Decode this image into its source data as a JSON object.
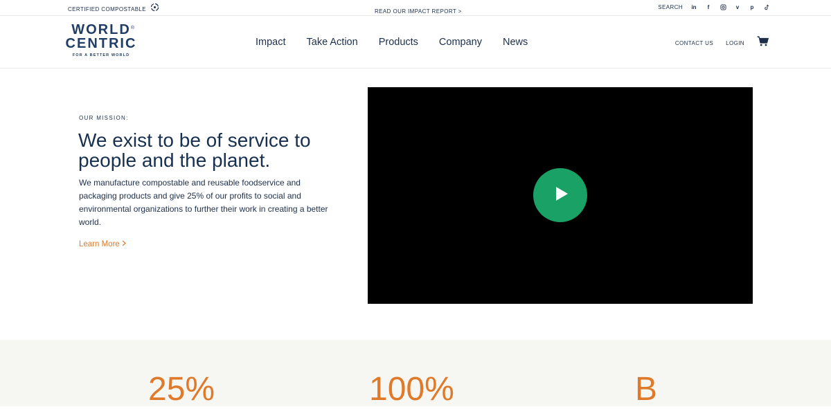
{
  "utility_bar": {
    "certified_label": "CERTIFIED COMPOSTABLE",
    "impact_report_link": "READ OUR IMPACT REPORT >",
    "search_label": "SEARCH",
    "socials": [
      "linkedin-icon",
      "facebook-icon",
      "instagram-icon",
      "vimeo-icon",
      "pinterest-icon",
      "tiktok-icon"
    ]
  },
  "header": {
    "logo": {
      "line1": "WORLD",
      "line2": "CENTRIC",
      "reg": "®",
      "tagline": "FOR A BETTER WORLD"
    },
    "nav": [
      "Impact",
      "Take Action",
      "Products",
      "Company",
      "News"
    ],
    "contact_label": "CONTACT US",
    "login_label": "LOGIN"
  },
  "hero": {
    "eyebrow": "OUR MISSION:",
    "title": "We exist to be of service to people and the planet.",
    "body": "We manufacture compostable and reusable foodservice and packaging products and give 25% of our profits to social and environmental organizations to further their work in creating a better world.",
    "learn_more": "Learn More",
    "learn_more_chevron": ">"
  },
  "stats": [
    "25%",
    "100%",
    "B"
  ],
  "colors": {
    "navy": "#1c2e4a",
    "orange": "#e07a2b",
    "play_green": "#1aa166",
    "stats_bg": "#f6f6f2"
  }
}
